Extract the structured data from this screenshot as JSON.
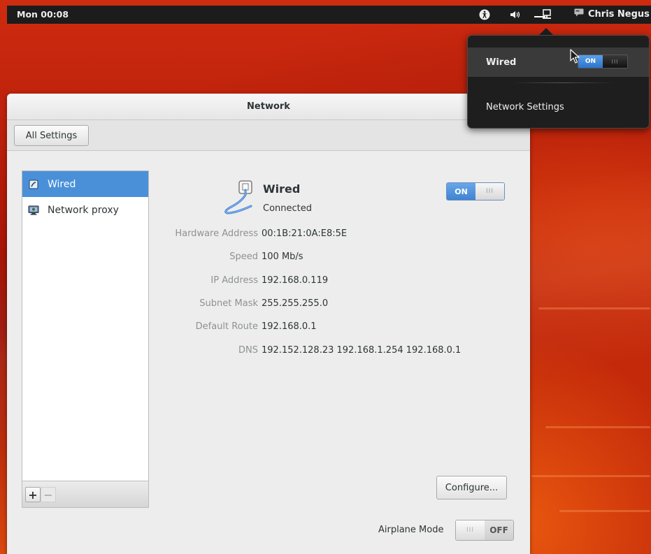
{
  "topbar": {
    "clock": "Mon 00:08",
    "user_name": "Chris Negus",
    "icons": [
      "accessibility-icon",
      "volume-icon",
      "network-wired-icon",
      "user-chat-icon"
    ]
  },
  "network_menu": {
    "wired_label": "Wired",
    "wired_switch": "ON",
    "settings_label": "Network Settings"
  },
  "window": {
    "title": "Network",
    "all_settings": "All Settings",
    "sidebar": {
      "items": [
        {
          "label": "Wired",
          "icon": "wired-icon",
          "selected": true
        },
        {
          "label": "Network proxy",
          "icon": "proxy-icon",
          "selected": false
        }
      ],
      "add": "+",
      "remove": "−"
    },
    "device": {
      "name": "Wired",
      "status": "Connected",
      "switch_on": "ON",
      "switch_knob": "III"
    },
    "details": [
      {
        "label": "Hardware Address",
        "value": "00:1B:21:0A:E8:5E"
      },
      {
        "label": "Speed",
        "value": "100 Mb/s"
      },
      {
        "label": "IP Address",
        "value": "192.168.0.119"
      },
      {
        "label": "Subnet Mask",
        "value": "255.255.255.0"
      },
      {
        "label": "Default Route",
        "value": "192.168.0.1"
      },
      {
        "label": "DNS",
        "value": "192.152.128.23 192.168.1.254 192.168.0.1"
      }
    ],
    "configure": "Configure...",
    "airplane_mode": {
      "label": "Airplane Mode",
      "state": "OFF",
      "knob": "III"
    }
  },
  "colors": {
    "accent": "#4a90d9",
    "topbar": "#1c1c1c",
    "desktop": "#b11a08"
  }
}
